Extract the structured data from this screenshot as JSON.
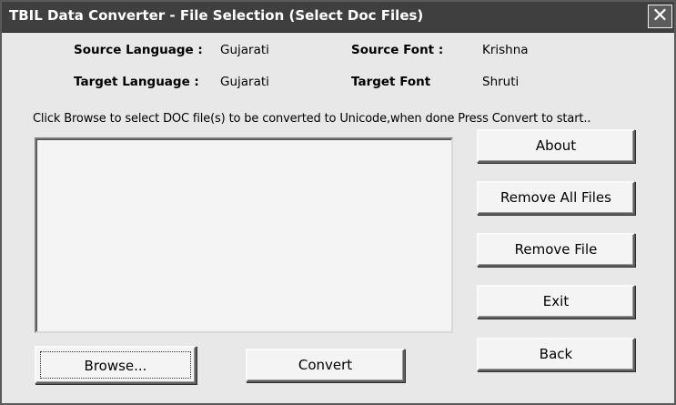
{
  "window": {
    "title": "TBIL Data Converter -  File Selection (Select Doc Files)",
    "close_glyph": "✕"
  },
  "info": {
    "source_language_label": "Source Language :",
    "source_language_value": "Gujarati",
    "source_font_label": "Source Font :",
    "source_font_value": "Krishna",
    "target_language_label": "Target Language :",
    "target_language_value": "Gujarati",
    "target_font_label": "Target Font",
    "target_font_value": "Shruti"
  },
  "instructions": "Click Browse to select DOC file(s) to be converted to Unicode,when done Press Convert to start..",
  "file_list": [],
  "buttons": {
    "about": "About",
    "remove_all": "Remove All Files",
    "remove_file": "Remove File",
    "exit": "Exit",
    "back": "Back",
    "browse": "Browse...",
    "convert": "Convert"
  },
  "colors": {
    "titlebar": "#3f3f3f",
    "window_bg": "#e8e8e8",
    "button_bg": "#f4f4f4",
    "list_bg": "#f4f4f4"
  }
}
